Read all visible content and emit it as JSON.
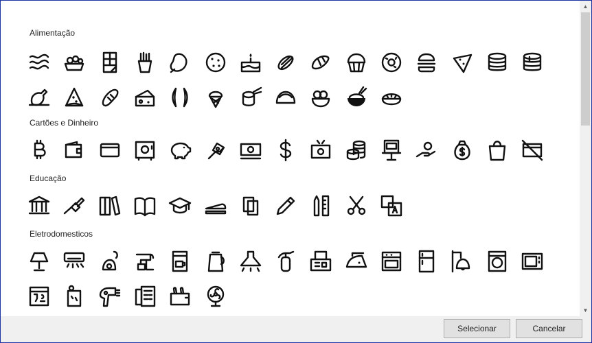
{
  "sections": [
    {
      "title": "Alimentação",
      "icons": [
        "bacon-icon",
        "cookies-basket-icon",
        "chocolate-bar-icon",
        "french-fries-icon",
        "meat-icon",
        "cookie-icon",
        "birthday-cake-icon",
        "hot-dog-icon",
        "croissant-icon",
        "muffin-icon",
        "donut-icon",
        "hamburger-icon",
        "nachos-icon",
        "pancake-stack-icon",
        "pancakes-icon",
        "roast-chicken-icon",
        "pizza-slice-icon",
        "bread-icon",
        "cheese-icon",
        "sausage-icon",
        "ice-cream-cone-icon",
        "sushi-icon",
        "taco-icon",
        "ice-cream-bowl-icon",
        "rice-bowl-icon",
        "pie-icon"
      ]
    },
    {
      "title": "Cartões e Dinheiro",
      "icons": [
        "bitcoin-icon",
        "wallet-icon",
        "credit-card-icon",
        "safe-icon",
        "piggy-bank-icon",
        "money-hand-icon",
        "banknote-icon",
        "dollar-icon",
        "money-transfer-icon",
        "coin-stack-icon",
        "atm-icon",
        "coin-hand-icon",
        "money-bag-icon",
        "shopping-bag-icon",
        "no-card-icon"
      ]
    },
    {
      "title": "Educação",
      "icons": [
        "museum-icon",
        "glue-icon",
        "books-icon",
        "open-book-icon",
        "graduation-cap-icon",
        "stapler-icon",
        "copy-pages-icon",
        "pencil-icon",
        "pencil-ruler-icon",
        "scissors-icon",
        "alphabet-blocks-icon"
      ]
    },
    {
      "title": "Eletrodomesticos",
      "icons": [
        "lamp-icon",
        "air-conditioner-icon",
        "vacuum-cleaner-icon",
        "mixer-icon",
        "coffee-maker-icon",
        "kettle-icon",
        "range-hood-icon",
        "fire-extinguisher-icon",
        "fax-icon",
        "iron-icon",
        "oven-icon",
        "refrigerator-icon",
        "doorbell-icon",
        "washing-machine-icon",
        "microwave-icon",
        "dishwasher-icon",
        "water-heater-icon",
        "hair-dryer-icon",
        "intercom-icon",
        "toaster-icon",
        "fan-icon"
      ]
    }
  ],
  "buttons": {
    "select": "Selecionar",
    "cancel": "Cancelar"
  },
  "scrollbar": {
    "up": "▲",
    "down": "▼",
    "position": 0.0
  }
}
